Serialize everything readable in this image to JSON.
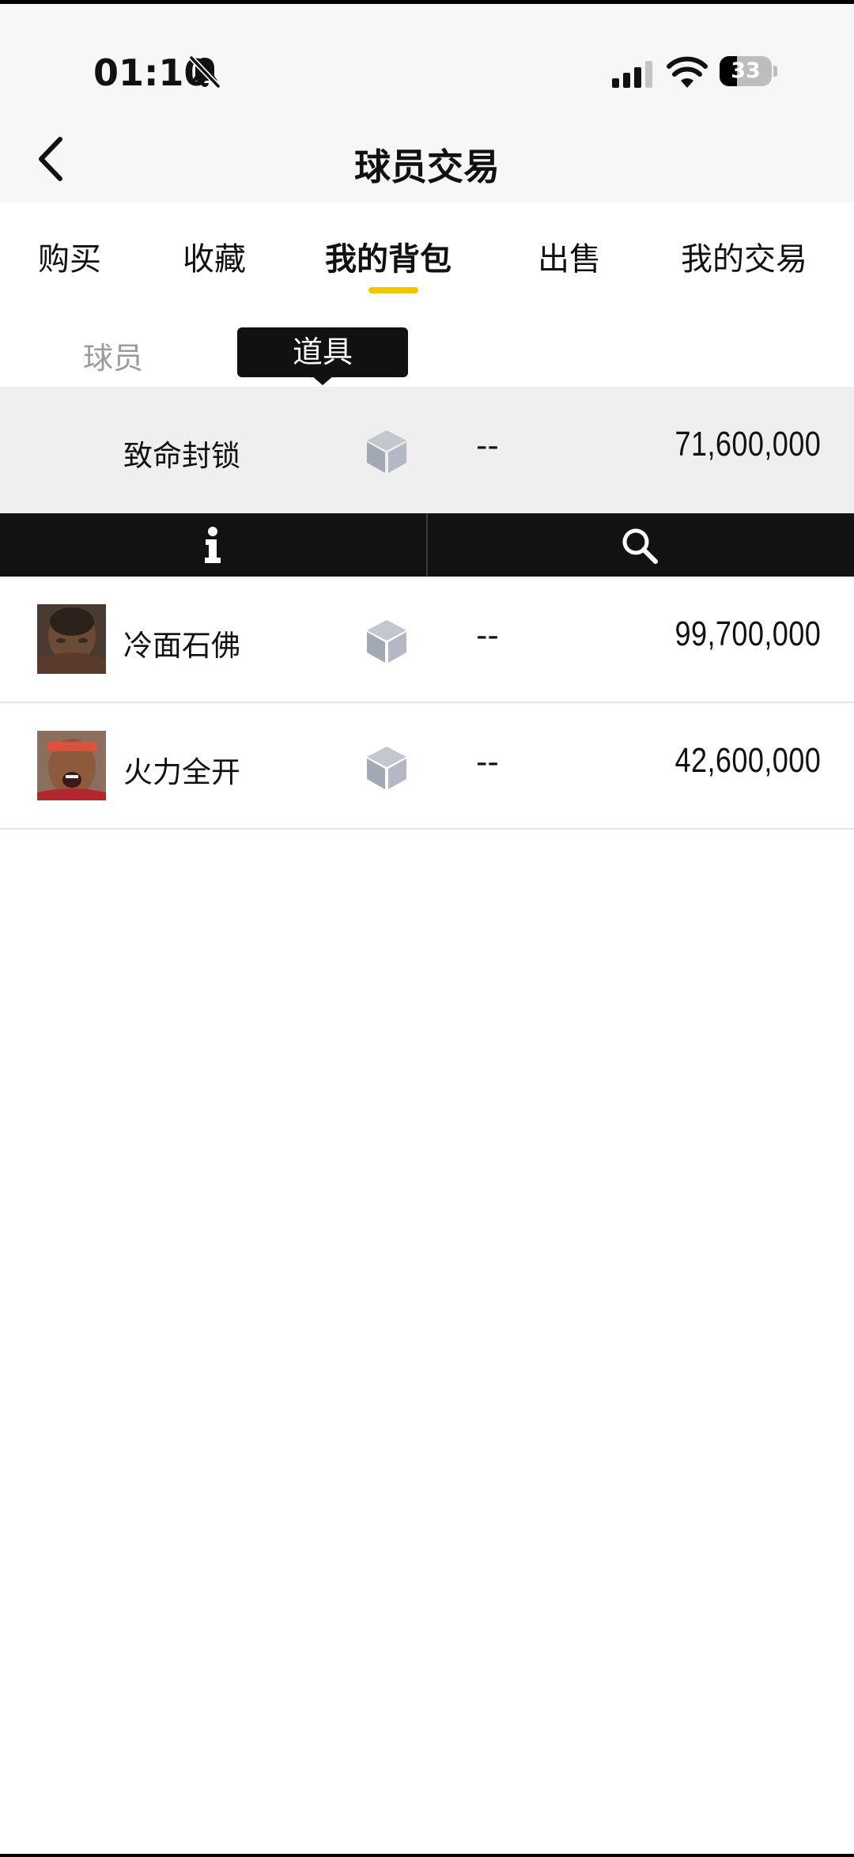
{
  "status_bar": {
    "time": "01:10",
    "battery": "33",
    "battery_level": 0.33
  },
  "header": {
    "title": "球员交易",
    "back_icon": "chevron-left-icon"
  },
  "main_tabs": [
    {
      "label": "购买",
      "active": false
    },
    {
      "label": "收藏",
      "active": false
    },
    {
      "label": "我的背包",
      "active": true
    },
    {
      "label": "出售",
      "active": false
    },
    {
      "label": "我的交易",
      "active": false
    }
  ],
  "sub_tabs": [
    {
      "label": "球员",
      "active": false
    },
    {
      "label": "道具",
      "active": true
    }
  ],
  "items": [
    {
      "name": "致命封锁",
      "dash": "--",
      "price": "71,600,000",
      "selected": true,
      "has_thumb": false
    },
    {
      "name": "冷面石佛",
      "dash": "--",
      "price": "99,700,000",
      "selected": false,
      "has_thumb": true
    },
    {
      "name": "火力全开",
      "dash": "--",
      "price": "42,600,000",
      "selected": false,
      "has_thumb": true
    }
  ],
  "action_bar": {
    "left_icon": "info-icon",
    "right_icon": "search-icon"
  },
  "colors": {
    "accent": "#f2c500",
    "dark": "#121212",
    "selected_row": "#efefef",
    "cube": "#a7acb8"
  }
}
